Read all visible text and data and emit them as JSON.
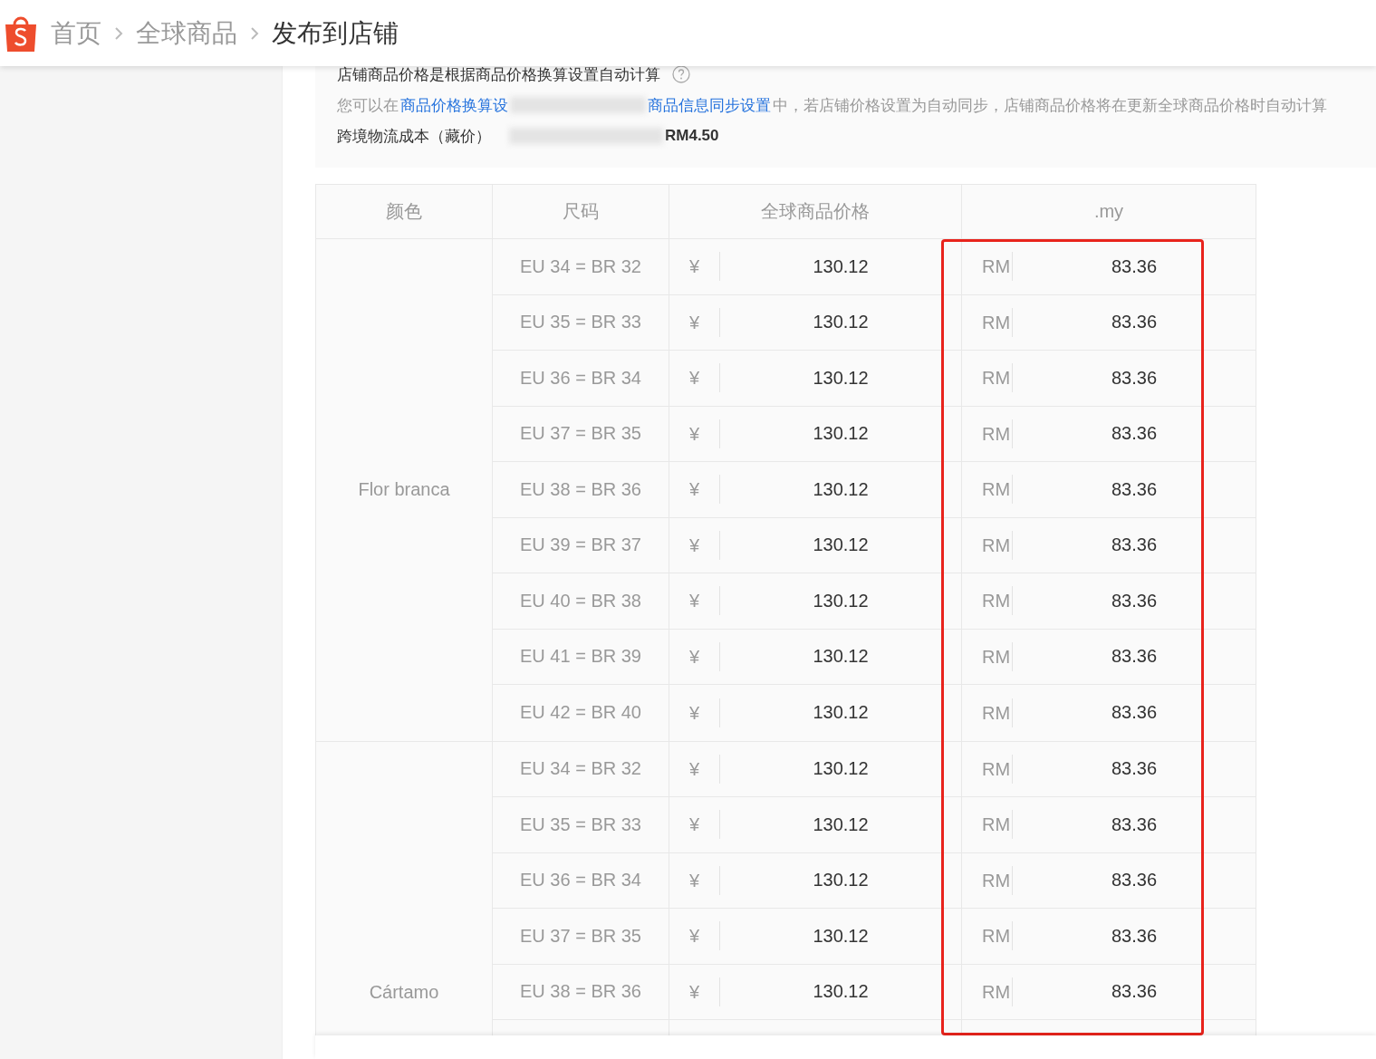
{
  "breadcrumb": [
    {
      "label": "首页",
      "selected": false
    },
    {
      "label": "全球商品",
      "selected": false
    },
    {
      "label": "发布到店铺",
      "selected": true
    }
  ],
  "info": {
    "line_1": "店铺商品价格是根据商品价格换算设置自动计算",
    "line_2_prefix": "您可以在",
    "link_1": "商品价格换算设",
    "link_2": "商品信息同步设置",
    "line_2_suffix": "中，若店铺价格设置为自动同步，店铺商品价格将在更新全球商品价格时自动计算",
    "cost_label": "跨境物流成本（藏价）",
    "cost_value": "RM4.50"
  },
  "table": {
    "columns": [
      "颜色",
      "尺码",
      "全球商品价格",
      ".my"
    ],
    "groups": [
      {
        "variant": "Flor branca",
        "rows": [
          {
            "size": "EU 34 = BR 32",
            "currency": "¥",
            "price": "130.12",
            "store_currency": "RM",
            "store_price": "83.36"
          },
          {
            "size": "EU 35 = BR 33",
            "currency": "¥",
            "price": "130.12",
            "store_currency": "RM",
            "store_price": "83.36"
          },
          {
            "size": "EU 36 = BR 34",
            "currency": "¥",
            "price": "130.12",
            "store_currency": "RM",
            "store_price": "83.36"
          },
          {
            "size": "EU 37 = BR 35",
            "currency": "¥",
            "price": "130.12",
            "store_currency": "RM",
            "store_price": "83.36"
          },
          {
            "size": "EU 38 = BR 36",
            "currency": "¥",
            "price": "130.12",
            "store_currency": "RM",
            "store_price": "83.36"
          },
          {
            "size": "EU 39 = BR 37",
            "currency": "¥",
            "price": "130.12",
            "store_currency": "RM",
            "store_price": "83.36"
          },
          {
            "size": "EU 40 = BR 38",
            "currency": "¥",
            "price": "130.12",
            "store_currency": "RM",
            "store_price": "83.36"
          },
          {
            "size": "EU 41 = BR 39",
            "currency": "¥",
            "price": "130.12",
            "store_currency": "RM",
            "store_price": "83.36"
          },
          {
            "size": "EU 42 = BR 40",
            "currency": "¥",
            "price": "130.12",
            "store_currency": "RM",
            "store_price": "83.36"
          }
        ]
      },
      {
        "variant": "Cártamo",
        "rows": [
          {
            "size": "EU 34 = BR 32",
            "currency": "¥",
            "price": "130.12",
            "store_currency": "RM",
            "store_price": "83.36"
          },
          {
            "size": "EU 35 = BR 33",
            "currency": "¥",
            "price": "130.12",
            "store_currency": "RM",
            "store_price": "83.36"
          },
          {
            "size": "EU 36 = BR 34",
            "currency": "¥",
            "price": "130.12",
            "store_currency": "RM",
            "store_price": "83.36"
          },
          {
            "size": "EU 37 = BR 35",
            "currency": "¥",
            "price": "130.12",
            "store_currency": "RM",
            "store_price": "83.36"
          },
          {
            "size": "EU 38 = BR 36",
            "currency": "¥",
            "price": "130.12",
            "store_currency": "RM",
            "store_price": "83.36"
          }
        ]
      }
    ]
  }
}
